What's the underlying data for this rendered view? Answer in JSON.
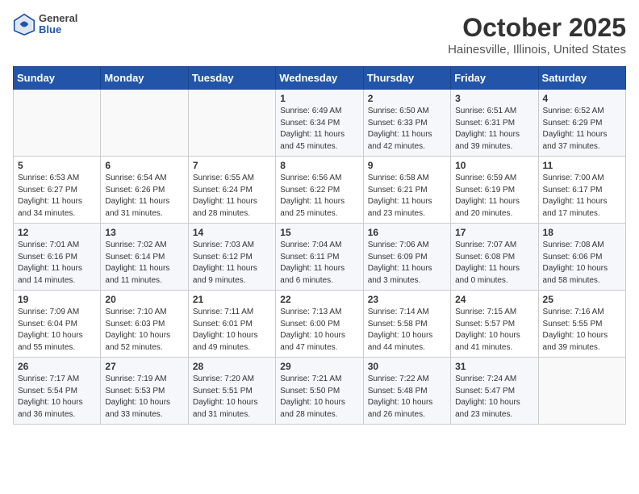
{
  "header": {
    "logo": {
      "general": "General",
      "blue": "Blue"
    },
    "title": "October 2025",
    "subtitle": "Hainesville, Illinois, United States"
  },
  "weekdays": [
    "Sunday",
    "Monday",
    "Tuesday",
    "Wednesday",
    "Thursday",
    "Friday",
    "Saturday"
  ],
  "weeks": [
    [
      {
        "day": "",
        "info": ""
      },
      {
        "day": "",
        "info": ""
      },
      {
        "day": "",
        "info": ""
      },
      {
        "day": "1",
        "info": "Sunrise: 6:49 AM\nSunset: 6:34 PM\nDaylight: 11 hours\nand 45 minutes."
      },
      {
        "day": "2",
        "info": "Sunrise: 6:50 AM\nSunset: 6:33 PM\nDaylight: 11 hours\nand 42 minutes."
      },
      {
        "day": "3",
        "info": "Sunrise: 6:51 AM\nSunset: 6:31 PM\nDaylight: 11 hours\nand 39 minutes."
      },
      {
        "day": "4",
        "info": "Sunrise: 6:52 AM\nSunset: 6:29 PM\nDaylight: 11 hours\nand 37 minutes."
      }
    ],
    [
      {
        "day": "5",
        "info": "Sunrise: 6:53 AM\nSunset: 6:27 PM\nDaylight: 11 hours\nand 34 minutes."
      },
      {
        "day": "6",
        "info": "Sunrise: 6:54 AM\nSunset: 6:26 PM\nDaylight: 11 hours\nand 31 minutes."
      },
      {
        "day": "7",
        "info": "Sunrise: 6:55 AM\nSunset: 6:24 PM\nDaylight: 11 hours\nand 28 minutes."
      },
      {
        "day": "8",
        "info": "Sunrise: 6:56 AM\nSunset: 6:22 PM\nDaylight: 11 hours\nand 25 minutes."
      },
      {
        "day": "9",
        "info": "Sunrise: 6:58 AM\nSunset: 6:21 PM\nDaylight: 11 hours\nand 23 minutes."
      },
      {
        "day": "10",
        "info": "Sunrise: 6:59 AM\nSunset: 6:19 PM\nDaylight: 11 hours\nand 20 minutes."
      },
      {
        "day": "11",
        "info": "Sunrise: 7:00 AM\nSunset: 6:17 PM\nDaylight: 11 hours\nand 17 minutes."
      }
    ],
    [
      {
        "day": "12",
        "info": "Sunrise: 7:01 AM\nSunset: 6:16 PM\nDaylight: 11 hours\nand 14 minutes."
      },
      {
        "day": "13",
        "info": "Sunrise: 7:02 AM\nSunset: 6:14 PM\nDaylight: 11 hours\nand 11 minutes."
      },
      {
        "day": "14",
        "info": "Sunrise: 7:03 AM\nSunset: 6:12 PM\nDaylight: 11 hours\nand 9 minutes."
      },
      {
        "day": "15",
        "info": "Sunrise: 7:04 AM\nSunset: 6:11 PM\nDaylight: 11 hours\nand 6 minutes."
      },
      {
        "day": "16",
        "info": "Sunrise: 7:06 AM\nSunset: 6:09 PM\nDaylight: 11 hours\nand 3 minutes."
      },
      {
        "day": "17",
        "info": "Sunrise: 7:07 AM\nSunset: 6:08 PM\nDaylight: 11 hours\nand 0 minutes."
      },
      {
        "day": "18",
        "info": "Sunrise: 7:08 AM\nSunset: 6:06 PM\nDaylight: 10 hours\nand 58 minutes."
      }
    ],
    [
      {
        "day": "19",
        "info": "Sunrise: 7:09 AM\nSunset: 6:04 PM\nDaylight: 10 hours\nand 55 minutes."
      },
      {
        "day": "20",
        "info": "Sunrise: 7:10 AM\nSunset: 6:03 PM\nDaylight: 10 hours\nand 52 minutes."
      },
      {
        "day": "21",
        "info": "Sunrise: 7:11 AM\nSunset: 6:01 PM\nDaylight: 10 hours\nand 49 minutes."
      },
      {
        "day": "22",
        "info": "Sunrise: 7:13 AM\nSunset: 6:00 PM\nDaylight: 10 hours\nand 47 minutes."
      },
      {
        "day": "23",
        "info": "Sunrise: 7:14 AM\nSunset: 5:58 PM\nDaylight: 10 hours\nand 44 minutes."
      },
      {
        "day": "24",
        "info": "Sunrise: 7:15 AM\nSunset: 5:57 PM\nDaylight: 10 hours\nand 41 minutes."
      },
      {
        "day": "25",
        "info": "Sunrise: 7:16 AM\nSunset: 5:55 PM\nDaylight: 10 hours\nand 39 minutes."
      }
    ],
    [
      {
        "day": "26",
        "info": "Sunrise: 7:17 AM\nSunset: 5:54 PM\nDaylight: 10 hours\nand 36 minutes."
      },
      {
        "day": "27",
        "info": "Sunrise: 7:19 AM\nSunset: 5:53 PM\nDaylight: 10 hours\nand 33 minutes."
      },
      {
        "day": "28",
        "info": "Sunrise: 7:20 AM\nSunset: 5:51 PM\nDaylight: 10 hours\nand 31 minutes."
      },
      {
        "day": "29",
        "info": "Sunrise: 7:21 AM\nSunset: 5:50 PM\nDaylight: 10 hours\nand 28 minutes."
      },
      {
        "day": "30",
        "info": "Sunrise: 7:22 AM\nSunset: 5:48 PM\nDaylight: 10 hours\nand 26 minutes."
      },
      {
        "day": "31",
        "info": "Sunrise: 7:24 AM\nSunset: 5:47 PM\nDaylight: 10 hours\nand 23 minutes."
      },
      {
        "day": "",
        "info": ""
      }
    ]
  ]
}
